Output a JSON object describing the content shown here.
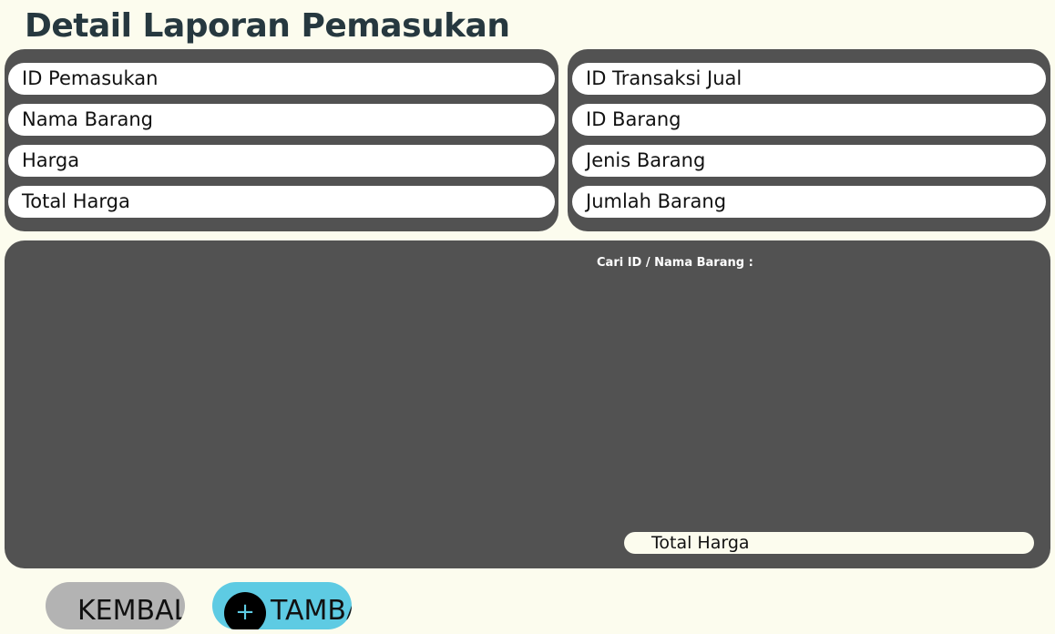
{
  "header": {
    "title": "Detail Laporan Pemasukan"
  },
  "form_left": {
    "fields": [
      "ID Pemasukan",
      "Nama Barang",
      "Harga",
      "Total Harga"
    ]
  },
  "form_right": {
    "fields": [
      "ID Transaksi Jual",
      "ID Barang",
      "Jenis Barang",
      "Jumlah Barang"
    ]
  },
  "table_panel": {
    "search_label": "Cari ID / Nama Barang :",
    "total_placeholder": "Total Harga"
  },
  "buttons": {
    "back_label": "KEMBALI",
    "add_label": "TAMBAH",
    "add_icon": "+"
  },
  "colors": {
    "background": "#fcfcee",
    "panel": "#525252",
    "title": "#26383f",
    "back_button": "#b3b3b3",
    "add_button": "#5ecbe3"
  }
}
